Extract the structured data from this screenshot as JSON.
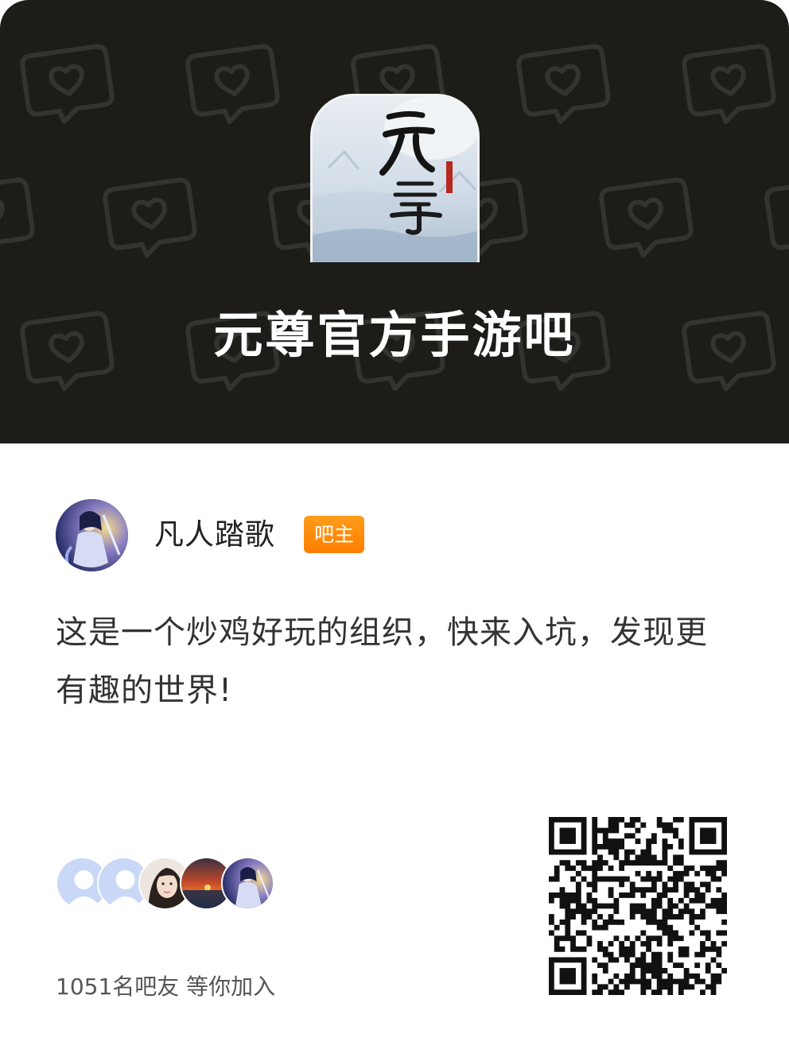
{
  "forum": {
    "name": "元尊官方手游吧",
    "logo_icon": "yuanzun-game-logo",
    "logo_text": "元尊"
  },
  "owner": {
    "avatar_icon": "anime-swordsman-avatar",
    "name": "凡人踏歌",
    "badge": "吧主"
  },
  "description": "这是一个炒鸡好玩的组织，快来入坑，发现更有趣的世界!",
  "members": {
    "avatars": [
      "default-user-avatar",
      "default-user-avatar",
      "woman-portrait-avatar",
      "sunset-avatar",
      "anime-swordsman-avatar"
    ],
    "summary": "1051名吧友 等你加入"
  },
  "qr": {
    "icon": "qr-code"
  },
  "colors": {
    "header_bg": "#1d1c19",
    "badge": "#ff8a00",
    "text_main": "#222222",
    "text_muted": "#555555"
  }
}
